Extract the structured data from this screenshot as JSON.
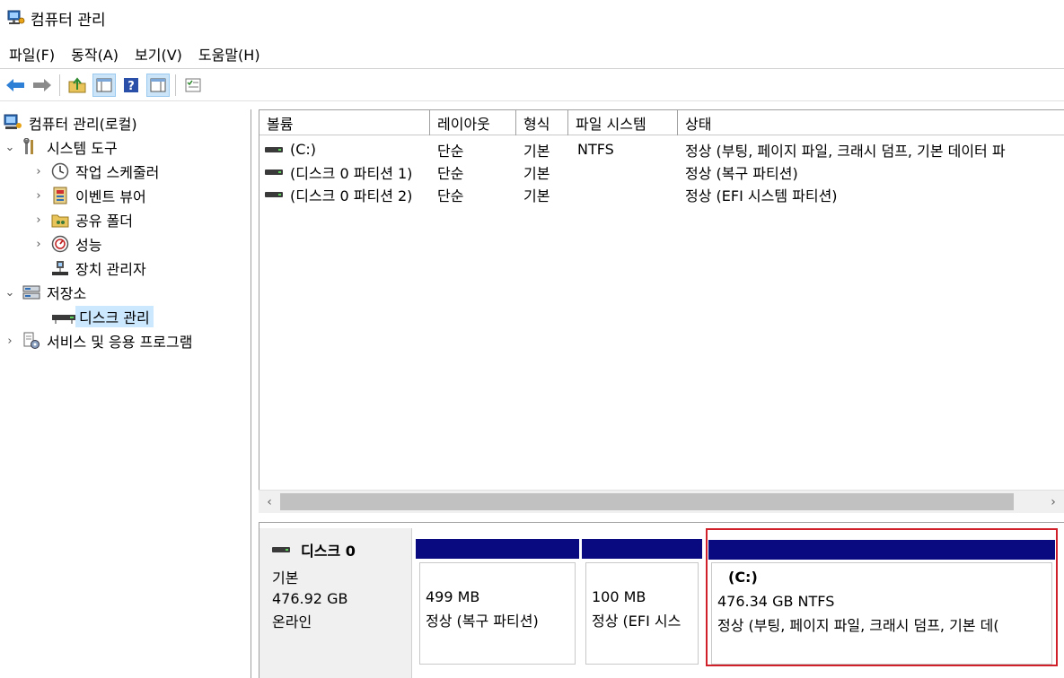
{
  "window": {
    "title": "컴퓨터 관리"
  },
  "menu": [
    {
      "label": "파일(F)",
      "name": "menu-file"
    },
    {
      "label": "동작(A)",
      "name": "menu-action"
    },
    {
      "label": "보기(V)",
      "name": "menu-view"
    },
    {
      "label": "도움말(H)",
      "name": "menu-help"
    }
  ],
  "tree": {
    "root": "컴퓨터 관리(로컬)",
    "system_tools": "시스템 도구",
    "task_scheduler": "작업 스케줄러",
    "event_viewer": "이벤트 뷰어",
    "shared_folders": "공유 폴더",
    "performance": "성능",
    "device_manager": "장치 관리자",
    "storage": "저장소",
    "disk_management": "디스크 관리",
    "services_apps": "서비스 및 응용 프로그램"
  },
  "columns": [
    "볼륨",
    "레이아웃",
    "형식",
    "파일 시스템",
    "상태"
  ],
  "volumes": [
    {
      "volume": "(C:)",
      "layout": "단순",
      "type": "기본",
      "fs": "NTFS",
      "status": "정상 (부팅, 페이지 파일, 크래시 덤프, 기본 데이터 파"
    },
    {
      "volume": "(디스크 0 파티션 1)",
      "layout": "단순",
      "type": "기본",
      "fs": "",
      "status": "정상 (복구 파티션)"
    },
    {
      "volume": "(디스크 0 파티션 2)",
      "layout": "단순",
      "type": "기본",
      "fs": "",
      "status": "정상 (EFI 시스템 파티션)"
    }
  ],
  "scroll": {
    "left_arrow": "‹",
    "right_arrow": "›"
  },
  "disk": {
    "name": "디스크 0",
    "type": "기본",
    "size": "476.92 GB",
    "state": "온라인",
    "partitions": [
      {
        "title": "",
        "size": "499 MB",
        "status": "정상 (복구 파티션)"
      },
      {
        "title": "",
        "size": "100 MB",
        "status": "정상 (EFI 시스"
      },
      {
        "title": "(C:)",
        "size": "476.34 GB NTFS",
        "status": "정상 (부팅, 페이지 파일, 크래시 덤프, 기본 데("
      }
    ]
  },
  "colors": {
    "partition_bar": "#0a0a80",
    "selection_border": "#d0202a",
    "selected_tree": "#cce8ff"
  }
}
